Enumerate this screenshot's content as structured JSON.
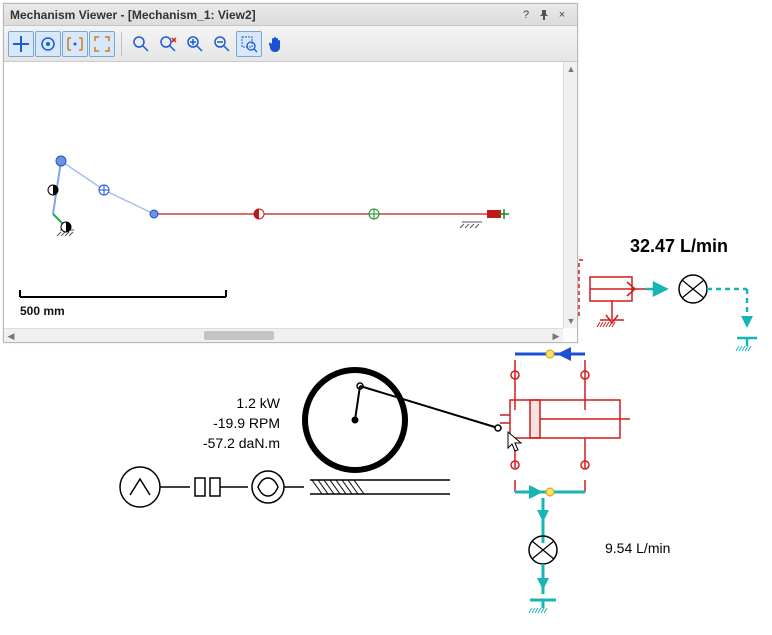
{
  "window": {
    "title": "Mechanism Viewer - [Mechanism_1: View2]",
    "help_tip": "?",
    "pin_tip": "📌",
    "close_tip": "×"
  },
  "toolbar": {
    "move": "Move",
    "target": "Center on target",
    "track": "Track",
    "fit_all": "Fit all",
    "zoom_window": "Magnify area",
    "zoom_reset": "Reset zoom",
    "zoom_in": "Zoom in",
    "zoom_out": "Zoom out",
    "select_area": "Select area",
    "pan": "Pan"
  },
  "canvas": {
    "scale_label": "500 mm"
  },
  "readouts": {
    "power": "1.2 kW",
    "speed": "-19.9 RPM",
    "torque": "-57.2 daN.m",
    "flow_top": "32.47 L/min",
    "flow_bottom": "9.54 L/min"
  },
  "colors": {
    "accent_blue": "#1b4fd6",
    "accent_red": "#d11c1c",
    "accent_teal": "#18b5b5",
    "node_green": "#1b8a1b",
    "node_red": "#c01818"
  }
}
